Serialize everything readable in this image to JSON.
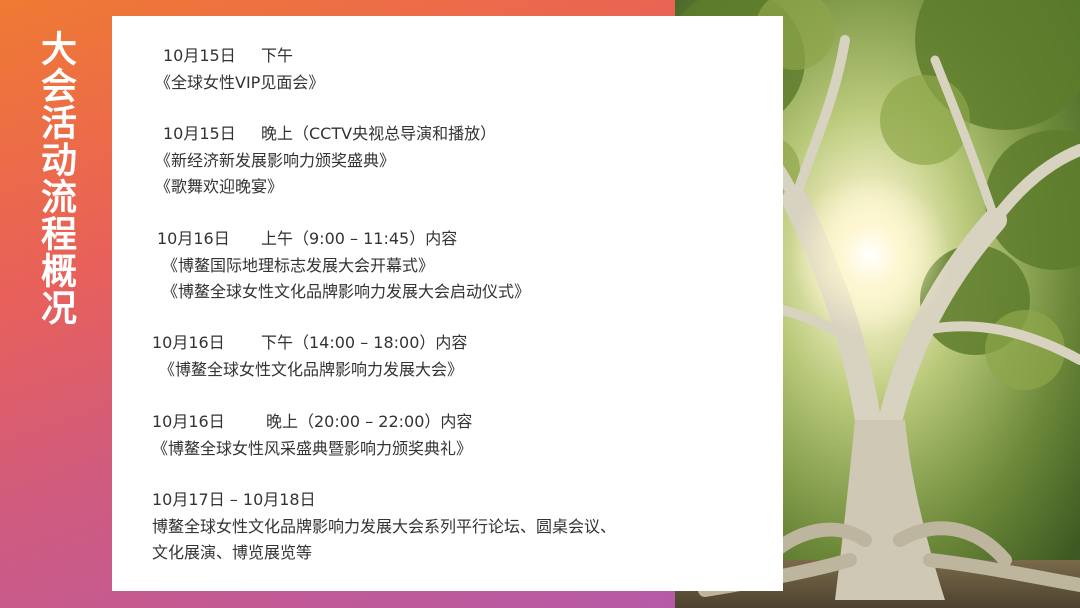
{
  "title": "大会活动流程概况",
  "schedule": {
    "b1": {
      "time": "10月15日",
      "period": "下午",
      "items": [
        "《全球女性VIP见面会》"
      ]
    },
    "b2": {
      "time": "10月15日",
      "period": "晚上（CCTV央视总导演和播放）",
      "items": [
        "《新经济新发展影响力颁奖盛典》",
        "《歌舞欢迎晚宴》"
      ]
    },
    "b3": {
      "time": "10月16日",
      "period": "上午（9:00 – 11:45）内容",
      "items": [
        "《博鳌国际地理标志发展大会开幕式》",
        "《博鳌全球女性文化品牌影响力发展大会启动仪式》"
      ]
    },
    "b4": {
      "time": "10月16日",
      "period": "下午（14:00 – 18:00）内容",
      "items": [
        "《博鳌全球女性文化品牌影响力发展大会》"
      ]
    },
    "b5": {
      "time": "10月16日",
      "period": "晚上（20:00 – 22:00）内容",
      "items": [
        "《博鳌全球女性风采盛典暨影响力颁奖典礼》"
      ]
    },
    "b6": {
      "time": "10月17日 – 10月18日",
      "items": [
        "博鳌全球女性文化品牌影响力发展大会系列平行论坛、圆桌会议、",
        "文化展演、博览展览等"
      ]
    }
  },
  "colors": {
    "gradient_start": "#f07a33",
    "gradient_end": "#b65aa8",
    "card": "#ffffff",
    "text": "#333333"
  }
}
